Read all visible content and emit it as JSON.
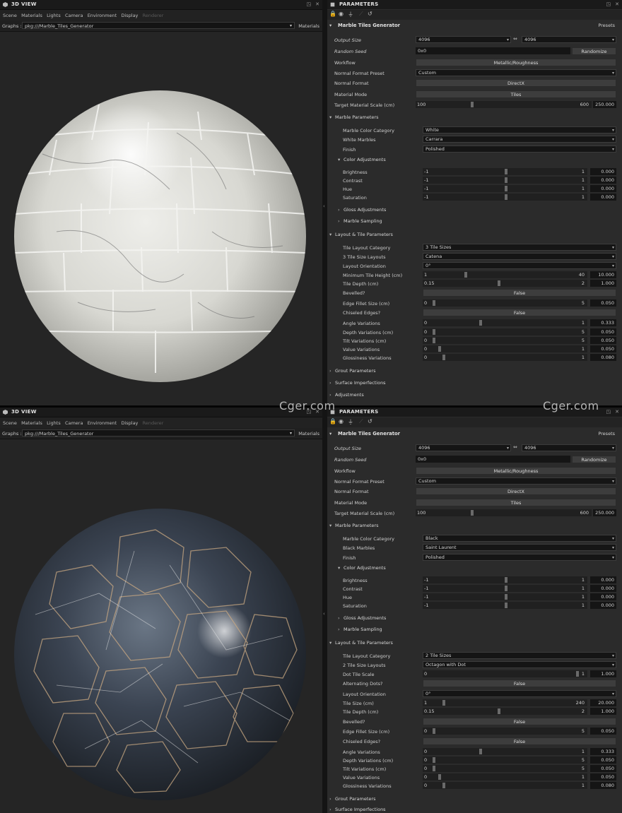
{
  "watermark": "Cger.com",
  "view": {
    "title": "3D VIEW",
    "menu": [
      "Scene",
      "Materials",
      "Lights",
      "Camera",
      "Environment",
      "Display"
    ],
    "menu_dim": "Renderer",
    "graphs_label": "Graphs :",
    "graph_path": "pkg:///Marble_Tiles_Generator",
    "materials_button": "Materials"
  },
  "params": {
    "title": "PARAMETERS",
    "header": "Marble Tiles Generator",
    "presets": "Presets",
    "output_size_label": "Output Size",
    "output_size_w": "4096",
    "output_size_h": "4096",
    "random_seed_label": "Random Seed",
    "random_seed_value": "0x0",
    "randomize": "Randomize",
    "workflow_label": "Workflow",
    "workflow_value": "Metallic/Roughness",
    "normal_preset_label": "Normal Format Preset",
    "normal_preset_value": "Custom",
    "normal_format_label": "Normal Format",
    "normal_format_value": "DirectX",
    "material_mode_label": "Material Mode",
    "material_mode_value": "Tiles",
    "target_scale_label": "Target Material Scale (cm)",
    "target_scale": {
      "min": "100",
      "max": "600",
      "value": "250.000",
      "pos": 0.3
    },
    "marble_params": "Marble Parameters",
    "marble_color_label": "Marble Color Category",
    "finish_label": "Finish",
    "finish_value": "Polished",
    "color_adjustments": "Color Adjustments",
    "brightness_label": "Brightness",
    "contrast_label": "Contrast",
    "hue_label": "Hue",
    "saturation_label": "Saturation",
    "neg_one": "-1",
    "one": "1",
    "zero_val": "0.000",
    "gloss_adjustments": "Gloss Adjustments",
    "marble_sampling": "Marble Sampling",
    "layout_params": "Layout & Tile Parameters",
    "tile_layout_label": "Tile Layout Category",
    "layout_orientation_label": "Layout Orientation",
    "orientation_value": "0°",
    "tile_depth_label": "Tile Depth (cm)",
    "bevelled_label": "Bevelled?",
    "false_label": "False",
    "edge_fillet_label": "Edge Fillet Size (cm)",
    "chiseled_label": "Chiseled Edges?",
    "angle_var_label": "Angle Variations",
    "depth_var_label": "Depth Variations (cm)",
    "tilt_var_label": "Tilt Variations (cm)",
    "value_var_label": "Value Variations",
    "gloss_var_label": "Glossiness Variations",
    "grout_params": "Grout Parameters",
    "surface_imperfections": "Surface Imperfections",
    "adjustments": "Adjustments"
  },
  "top": {
    "marble_color_value": "White",
    "marbles_label": "White Marbles",
    "marbles_value": "Carrara",
    "tile_layout_value": "3 Tile Sizes",
    "size_layouts_label": "3 Tile Size Layouts",
    "size_layouts_value": "Catena",
    "min_tile_height_label": "Minimum Tile Height (cm)",
    "min_tile_height": {
      "min": "1",
      "max": "40",
      "value": "10.000",
      "pos": 0.23
    },
    "tile_depth": {
      "min": "0.15",
      "max": "2",
      "value": "1.000",
      "pos": 0.46
    },
    "edge_fillet": {
      "min": "0",
      "max": "5",
      "value": "0.050",
      "pos": 0.01
    },
    "angle_var": {
      "min": "0",
      "max": "1",
      "value": "0.333",
      "pos": 0.333
    },
    "depth_var": {
      "min": "0",
      "max": "5",
      "value": "0.050",
      "pos": 0.01
    },
    "tilt_var": {
      "min": "0",
      "max": "5",
      "value": "0.050",
      "pos": 0.01
    },
    "value_var": {
      "min": "0",
      "max": "1",
      "value": "0.050",
      "pos": 0.05
    },
    "gloss_var": {
      "min": "0",
      "max": "1",
      "value": "0.080",
      "pos": 0.08
    }
  },
  "bottom": {
    "marble_color_value": "Black",
    "marbles_label": "Black Marbles",
    "marbles_value": "Saint Laurent",
    "tile_layout_value": "2 Tile Sizes",
    "size_layouts_label": "2 Tile Size Layouts",
    "size_layouts_value": "Octagon with Dot",
    "dot_scale_label": "Dot Tile Scale",
    "dot_scale": {
      "min": "0",
      "max": "1",
      "value": "1.000",
      "pos": 1.0
    },
    "alternating_dots_label": "Alternating Dots?",
    "tile_size_label": "Tile Size (cm)",
    "tile_size": {
      "min": "1",
      "max": "240",
      "value": "20.000",
      "pos": 0.08
    },
    "tile_depth": {
      "min": "0.15",
      "max": "2",
      "value": "1.000",
      "pos": 0.46
    },
    "edge_fillet": {
      "min": "0",
      "max": "5",
      "value": "0.050",
      "pos": 0.01
    },
    "angle_var": {
      "min": "0",
      "max": "1",
      "value": "0.333",
      "pos": 0.333
    },
    "depth_var": {
      "min": "0",
      "max": "5",
      "value": "0.050",
      "pos": 0.01
    },
    "tilt_var": {
      "min": "0",
      "max": "5",
      "value": "0.050",
      "pos": 0.01
    },
    "value_var": {
      "min": "0",
      "max": "1",
      "value": "0.050",
      "pos": 0.05
    },
    "gloss_var": {
      "min": "0",
      "max": "1",
      "value": "0.080",
      "pos": 0.08
    }
  }
}
